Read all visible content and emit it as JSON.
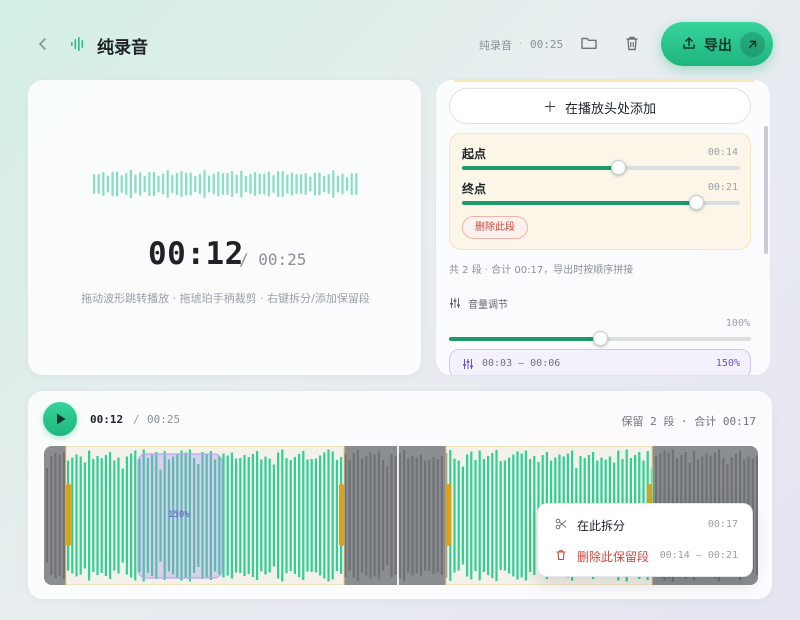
{
  "header": {
    "title": "纯录音",
    "file_name": "纯录音",
    "dot": "·",
    "duration": "00:25",
    "export_label": "导出"
  },
  "preview": {
    "current_time": "00:12",
    "total_time": "/ 00:25",
    "hint": "拖动波形跳转播放 · 拖琥珀手柄裁剪 · 右键拆分/添加保留段"
  },
  "side_panel": {
    "add_label": "在播放头处添加",
    "segment": {
      "start_label": "起点",
      "start_time": "00:14",
      "start_fraction": 0.56,
      "end_label": "终点",
      "end_time": "00:21",
      "end_fraction": 0.84,
      "delete_label": "删除此段"
    },
    "summary": "共 2 段 · 合计 00:17，导出时按顺序拼接",
    "volume": {
      "label": "音量调节",
      "percent": "100%",
      "fraction": 0.5,
      "range_label": "00:03 – 00:06",
      "range_percent": "150%"
    }
  },
  "timeline": {
    "current_time": "00:12",
    "separator": "/",
    "total_time": "00:25",
    "keep_summary": "保留 2 段 · 合计 00:17",
    "boost_label": "150%"
  },
  "context_menu": {
    "split_label": "在此拆分",
    "split_time": "00:17",
    "delete_label": "删除此保留段",
    "delete_range": "00:14 – 00:21"
  },
  "colors": {
    "accent": "#1fb57e",
    "wave": "#2fcf95",
    "handle": "#d9a21b",
    "danger": "#c84a3f",
    "boost": "#6a56c9"
  }
}
